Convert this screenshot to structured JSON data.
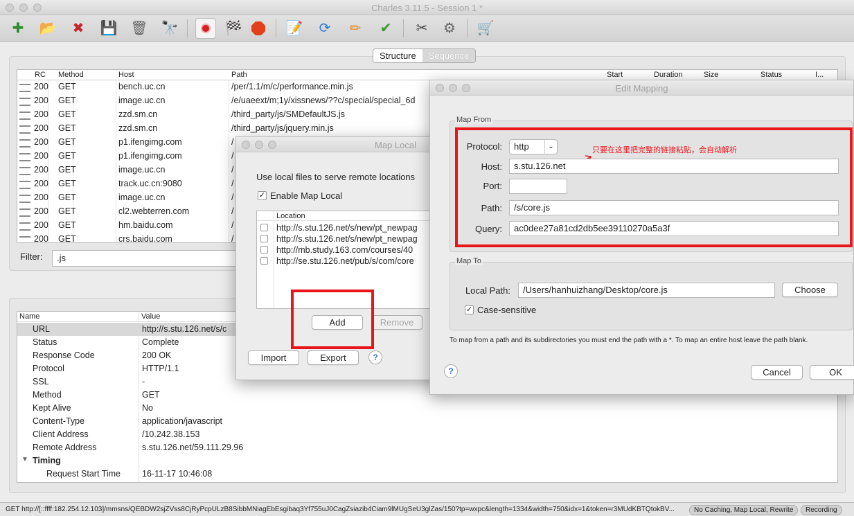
{
  "window": {
    "title": "Charles 3.11.5 - Session 1 *"
  },
  "toolbar": {
    "icons": [
      "new-session-icon",
      "open-session-icon",
      "close-session-icon",
      "save-session-icon",
      "clear-session-icon",
      "find-icon",
      "record-icon",
      "throttle-flag-icon",
      "stop-breakpoints-icon",
      "edit-request-icon",
      "repeat-icon",
      "pencil-icon",
      "validate-icon",
      "tools-icon",
      "settings-icon",
      "shopping-cart-icon"
    ]
  },
  "view_tabs": {
    "structure": "Structure",
    "sequence": "Sequence"
  },
  "requests": {
    "headers": {
      "rc": "RC",
      "method": "Method",
      "host": "Host",
      "path": "Path",
      "start": "Start",
      "duration": "Duration",
      "size": "Size",
      "status": "Status",
      "info": "I..."
    },
    "rows": [
      {
        "rc": "200",
        "method": "GET",
        "host": "bench.uc.cn",
        "path": "/per/1.1/m/c/performance.min.js"
      },
      {
        "rc": "200",
        "method": "GET",
        "host": "image.uc.cn",
        "path": "/e/uaeext/m;1y/xissnews/??c/special/special_6d"
      },
      {
        "rc": "200",
        "method": "GET",
        "host": "zzd.sm.cn",
        "path": "/third_party/js/SMDefaultJS.js"
      },
      {
        "rc": "200",
        "method": "GET",
        "host": "zzd.sm.cn",
        "path": "/third_party/js/jquery.min.js"
      },
      {
        "rc": "200",
        "method": "GET",
        "host": "p1.ifengimg.com",
        "path": "/"
      },
      {
        "rc": "200",
        "method": "GET",
        "host": "p1.ifengimg.com",
        "path": "/"
      },
      {
        "rc": "200",
        "method": "GET",
        "host": "image.uc.cn",
        "path": "/"
      },
      {
        "rc": "200",
        "method": "GET",
        "host": "track.uc.cn:9080",
        "path": "/"
      },
      {
        "rc": "200",
        "method": "GET",
        "host": "image.uc.cn",
        "path": "/"
      },
      {
        "rc": "200",
        "method": "GET",
        "host": "cl2.webterren.com",
        "path": "/"
      },
      {
        "rc": "200",
        "method": "GET",
        "host": "hm.baidu.com",
        "path": "/"
      },
      {
        "rc": "200",
        "method": "GET",
        "host": "crs.baidu.com",
        "path": "/"
      }
    ]
  },
  "filter": {
    "label": "Filter:",
    "value": ".js"
  },
  "properties": {
    "headers": {
      "name": "Name",
      "value": "Value"
    },
    "rows": [
      {
        "name": "URL",
        "value": "http://s.stu.126.net/s/c"
      },
      {
        "name": "Status",
        "value": "Complete"
      },
      {
        "name": "Response Code",
        "value": "200 OK"
      },
      {
        "name": "Protocol",
        "value": "HTTP/1.1"
      },
      {
        "name": "SSL",
        "value": "-"
      },
      {
        "name": "Method",
        "value": "GET"
      },
      {
        "name": "Kept Alive",
        "value": "No"
      },
      {
        "name": "Content-Type",
        "value": "application/javascript"
      },
      {
        "name": "Client Address",
        "value": "/10.242.38.153"
      },
      {
        "name": "Remote Address",
        "value": "s.stu.126.net/59.111.29.96"
      },
      {
        "name": "Timing",
        "value": ""
      },
      {
        "name": "Request Start Time",
        "value": "16-11-17 10:46:08"
      }
    ]
  },
  "status_bar": {
    "text": "GET http://[::ffff:182.254.12.103]/mmsns/QEBDW2sjZVss8CjRyPcpULzB8SibbMNiagEbEsgibaq3Yf755uJ0CagZsiazib4Ciam9lMUgSeU3glZas/150?tp=wxpc&length=1334&width=750&idx=1&token=r3MUdKBTQtokBV...",
    "badge1": "No Caching, Map Local, Rewrite",
    "badge2": "Recording"
  },
  "map_local": {
    "title": "Map Local",
    "description": "Use local files to serve remote locations",
    "enable_label": "Enable Map Local",
    "location_header": "Location",
    "locations": [
      "http://s.stu.126.net/s/new/pt_newpag",
      "http://s.stu.126.net/s/new/pt_newpag",
      "http://mb.study.163.com/courses/40",
      "http://se.stu.126.net/pub/s/com/core"
    ],
    "add": "Add",
    "remove": "Remove",
    "import": "Import",
    "export": "Export",
    "help": "?"
  },
  "edit_mapping": {
    "title": "Edit Mapping",
    "map_from_label": "Map From",
    "protocol_label": "Protocol:",
    "protocol": "http",
    "host_label": "Host:",
    "host": "s.stu.126.net",
    "port_label": "Port:",
    "port": "",
    "path_label": "Path:",
    "path": "/s/core.js",
    "query_label": "Query:",
    "query": "ac0dee27a81cd2db5ee39110270a5a3f",
    "annotation": "只要在这里把完整的链接粘贴，会自动解析",
    "map_to_label": "Map To",
    "local_path_label": "Local Path:",
    "local_path": "/Users/hanhuizhang/Desktop/core.js",
    "choose": "Choose",
    "case_sensitive": "Case-sensitive",
    "hint": "To map from a path and its subdirectories you must end the path with a *. To map an entire host leave the path blank.",
    "cancel": "Cancel",
    "ok": "OK",
    "help": "?"
  },
  "colors": {
    "highlight": "#e8151b",
    "annotation": "#e8151b"
  }
}
